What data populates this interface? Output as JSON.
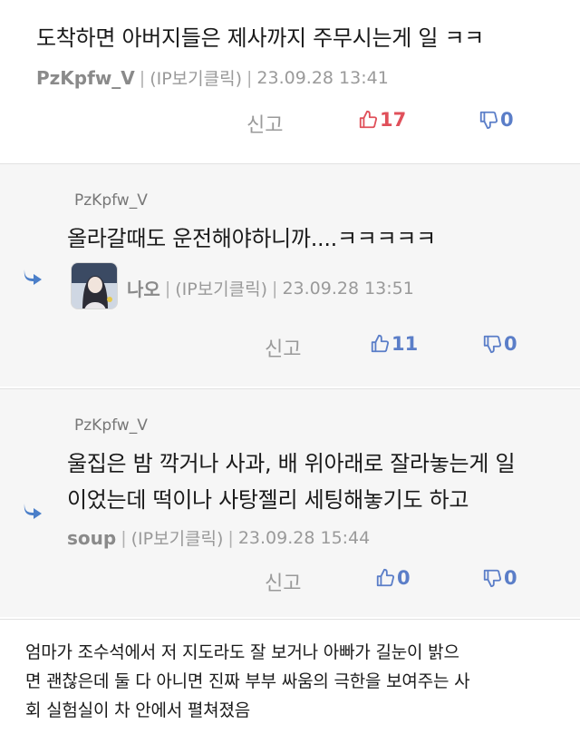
{
  "comments": [
    {
      "text": "도착하면 아버지들은 제사까지 주무시는게 일 ㅋㅋ",
      "nick": "PzKpfw_V",
      "ip": "(IP보기클릭)",
      "time": "23.09.28 13:41",
      "report": "신고",
      "likes": "17",
      "dislikes": "0"
    },
    {
      "reply_to": "PzKpfw_V",
      "text": "올라갈때도 운전해야하니까....ㅋㅋㅋㅋㅋ",
      "nick": "나오",
      "ip": "(IP보기클릭)",
      "time": "23.09.28 13:51",
      "report": "신고",
      "likes": "11",
      "dislikes": "0"
    },
    {
      "reply_to": "PzKpfw_V",
      "text_line1": "울집은 밤 깍거나 사과, 배 위아래로 잘라놓는게 일",
      "text_line2": "이었는데 떡이나 사탕젤리 세팅해놓기도 하고",
      "nick": "soup",
      "ip": "(IP보기클릭)",
      "time": "23.09.28 15:44",
      "report": "신고",
      "likes": "0",
      "dislikes": "0"
    }
  ],
  "post": {
    "line1": "엄마가 조수석에서 저 지도라도 잘 보거나 아빠가 길눈이 밝으",
    "line2": "면 괜찮은데 둘 다 아니면 진짜 부부 싸움의 극한을 보여주는 사",
    "line3": "회 실험실이 차 안에서 펼쳐졌음"
  },
  "colors": {
    "like_hot": "#e0505a",
    "accent": "#5b7ec8",
    "reply_bg": "#f6f6f6"
  },
  "icons": [
    "thumbs-up-icon",
    "thumbs-down-icon",
    "reply-arrow-icon",
    "avatar"
  ]
}
